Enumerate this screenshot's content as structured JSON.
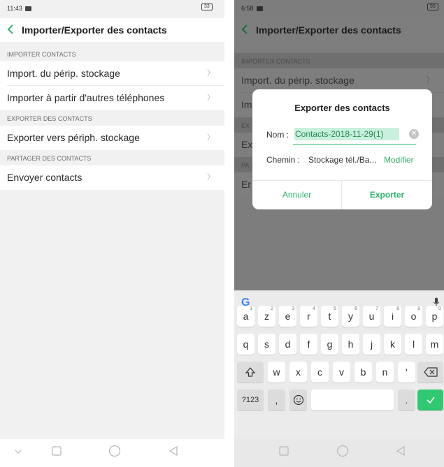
{
  "left_screen": {
    "status": {
      "time": "11:43",
      "battery": "33"
    },
    "title": "Importer/Exporter des contacts",
    "sections": [
      {
        "header": "IMPORTER CONTACTS",
        "items": [
          "Import. du périp. stockage",
          "Importer à partir d'autres téléphones"
        ]
      },
      {
        "header": "EXPORTER DES CONTACTS",
        "items": [
          "Exporter vers périph. stockage"
        ]
      },
      {
        "header": "PARTAGER DES CONTACTS",
        "items": [
          "Envoyer contacts"
        ]
      }
    ]
  },
  "right_screen": {
    "status": {
      "time": "6:58",
      "battery": "95"
    },
    "title": "Importer/Exporter des contacts",
    "background_list": {
      "header_1": "IMPORTER CONTACTS",
      "item_1": "Import. du périp. stockage",
      "item_2_prefix": "Im",
      "header_2_prefix": "EX",
      "item_3_prefix": "Ex",
      "header_3_prefix": "PA",
      "item_4_prefix": "Er"
    },
    "dialog": {
      "title": "Exporter des contacts",
      "name_label": "Nom :",
      "name_value": "Contacts-2018-11-29(1)",
      "path_label": "Chemin :",
      "path_value": "Stockage tél./Ba...",
      "modify": "Modifier",
      "cancel": "Annuler",
      "export": "Exporter"
    },
    "keyboard": {
      "row1": [
        "a",
        "z",
        "e",
        "r",
        "t",
        "y",
        "u",
        "i",
        "o",
        "p"
      ],
      "row1_hints": [
        "1",
        "2",
        "3",
        "4",
        "5",
        "6",
        "7",
        "8",
        "9",
        "0"
      ],
      "row2": [
        "q",
        "s",
        "d",
        "f",
        "g",
        "h",
        "j",
        "k",
        "l",
        "m"
      ],
      "row3": [
        "w",
        "x",
        "c",
        "v",
        "b",
        "n",
        "'"
      ],
      "symbols_key": "?123",
      "comma_key": ",",
      "period_key": "."
    }
  },
  "colors": {
    "accent": "#2fb36a",
    "selection": "#c8f0dc",
    "enter_key": "#2fc971",
    "overlay": "#7e7e7e"
  }
}
